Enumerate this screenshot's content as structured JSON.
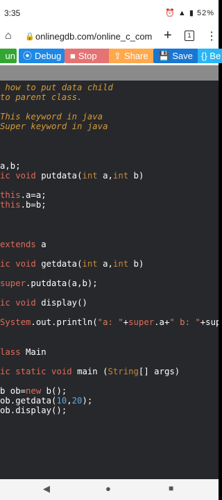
{
  "status_bar": {
    "time": "3:35",
    "battery": "52%"
  },
  "browser": {
    "url": "onlinegdb.com/online_c_com",
    "tab_count": "1"
  },
  "toolbar": {
    "run_label": "un",
    "debug_label": "Debug",
    "stop_label": "Stop",
    "share_label": "Share",
    "save_label": "Save",
    "beautify_label": "{} Be",
    "colors": {
      "run": "#33a532",
      "debug": "#1e88e5",
      "stop": "#e57373",
      "share": "#ffa94d",
      "save": "#1976d2",
      "beautify": "#29b6f6"
    }
  },
  "editor": {
    "lines": [
      " how to put data child",
      "to parent class.",
      "",
      "This keyword in java",
      "Super keyword in java",
      "",
      "",
      "",
      "a,b;",
      "ic void putdata(int a,int b)",
      "",
      "this.a=a;",
      "this.b=b;",
      "",
      "",
      "",
      "extends a",
      "",
      "ic void getdata(int a,int b)",
      "",
      "super.putdata(a,b);",
      "",
      "ic void display()",
      "",
      "System.out.println(\"a: \"+super.a+\" b: \"+sup",
      "",
      "",
      "lass Main",
      "",
      "ic static void main (String[] args)",
      "",
      "b ob=new b();",
      "ob.getdata(10,20);",
      "ob.display();"
    ]
  }
}
